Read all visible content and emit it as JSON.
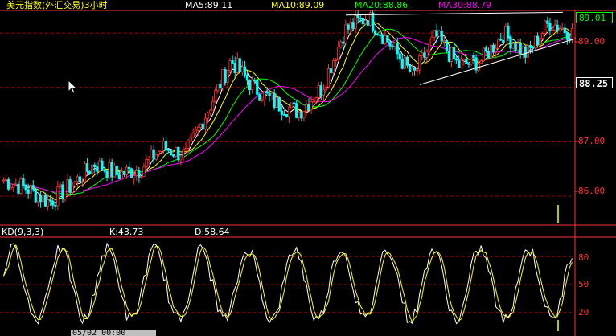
{
  "header": {
    "title": "美元指数(外汇交易)3小时",
    "ma5": "MA5:89.11",
    "ma10": "MA10:89.09",
    "ma20": "MA20:88.86",
    "ma30": "MA30:88.79"
  },
  "colors": {
    "title": "#ffff00",
    "ma5": "#ffffff",
    "ma10": "#ffff00",
    "ma20": "#00ff00",
    "ma30": "#ff00ff",
    "up": "#ff3232",
    "down": "#00ffff",
    "grid": "#990000",
    "axis": "#ff3232",
    "k_line": "#ffffff",
    "d_line": "#ffff00",
    "trendline": "#ffffff"
  },
  "price_axis": {
    "labels": [
      "89.00",
      "87.00",
      "86.00"
    ],
    "current_price": "88.25",
    "last_price": "89.01"
  },
  "kd_panel": {
    "title": "KD(9,3,3)",
    "k": "K:43.73",
    "d": "D:58.64",
    "levels": [
      "80",
      "50",
      "20"
    ]
  },
  "crosshair_time": "05/02 00:00",
  "chart_data": [
    {
      "type": "candlestick",
      "title": "美元指数(外汇交易)3小时",
      "ylim": [
        85.5,
        89.4
      ],
      "y_ticks": [
        86.0,
        87.0,
        89.0
      ],
      "series": [
        {
          "name": "MA5",
          "value": 89.11
        },
        {
          "name": "MA10",
          "value": 89.09
        },
        {
          "name": "MA20",
          "value": 88.86
        },
        {
          "name": "MA30",
          "value": 88.79
        }
      ],
      "close_anchors": [
        86.3,
        86.15,
        85.9,
        86.2,
        86.6,
        86.4,
        86.5,
        86.9,
        86.75,
        87.6,
        88.5,
        88.0,
        87.7,
        87.55,
        88.0,
        89.05,
        89.3,
        88.8,
        88.2,
        88.95,
        88.4,
        88.5,
        89.0,
        88.6,
        89.2,
        89.0
      ],
      "last_price": 89.01,
      "current_price": 88.25
    },
    {
      "type": "line",
      "title": "KD(9,3,3)",
      "ylim": [
        0,
        100
      ],
      "y_ticks": [
        20,
        50,
        80
      ],
      "series": [
        {
          "name": "K",
          "value": 43.73
        },
        {
          "name": "D",
          "value": 58.64
        }
      ],
      "grid": true
    }
  ]
}
